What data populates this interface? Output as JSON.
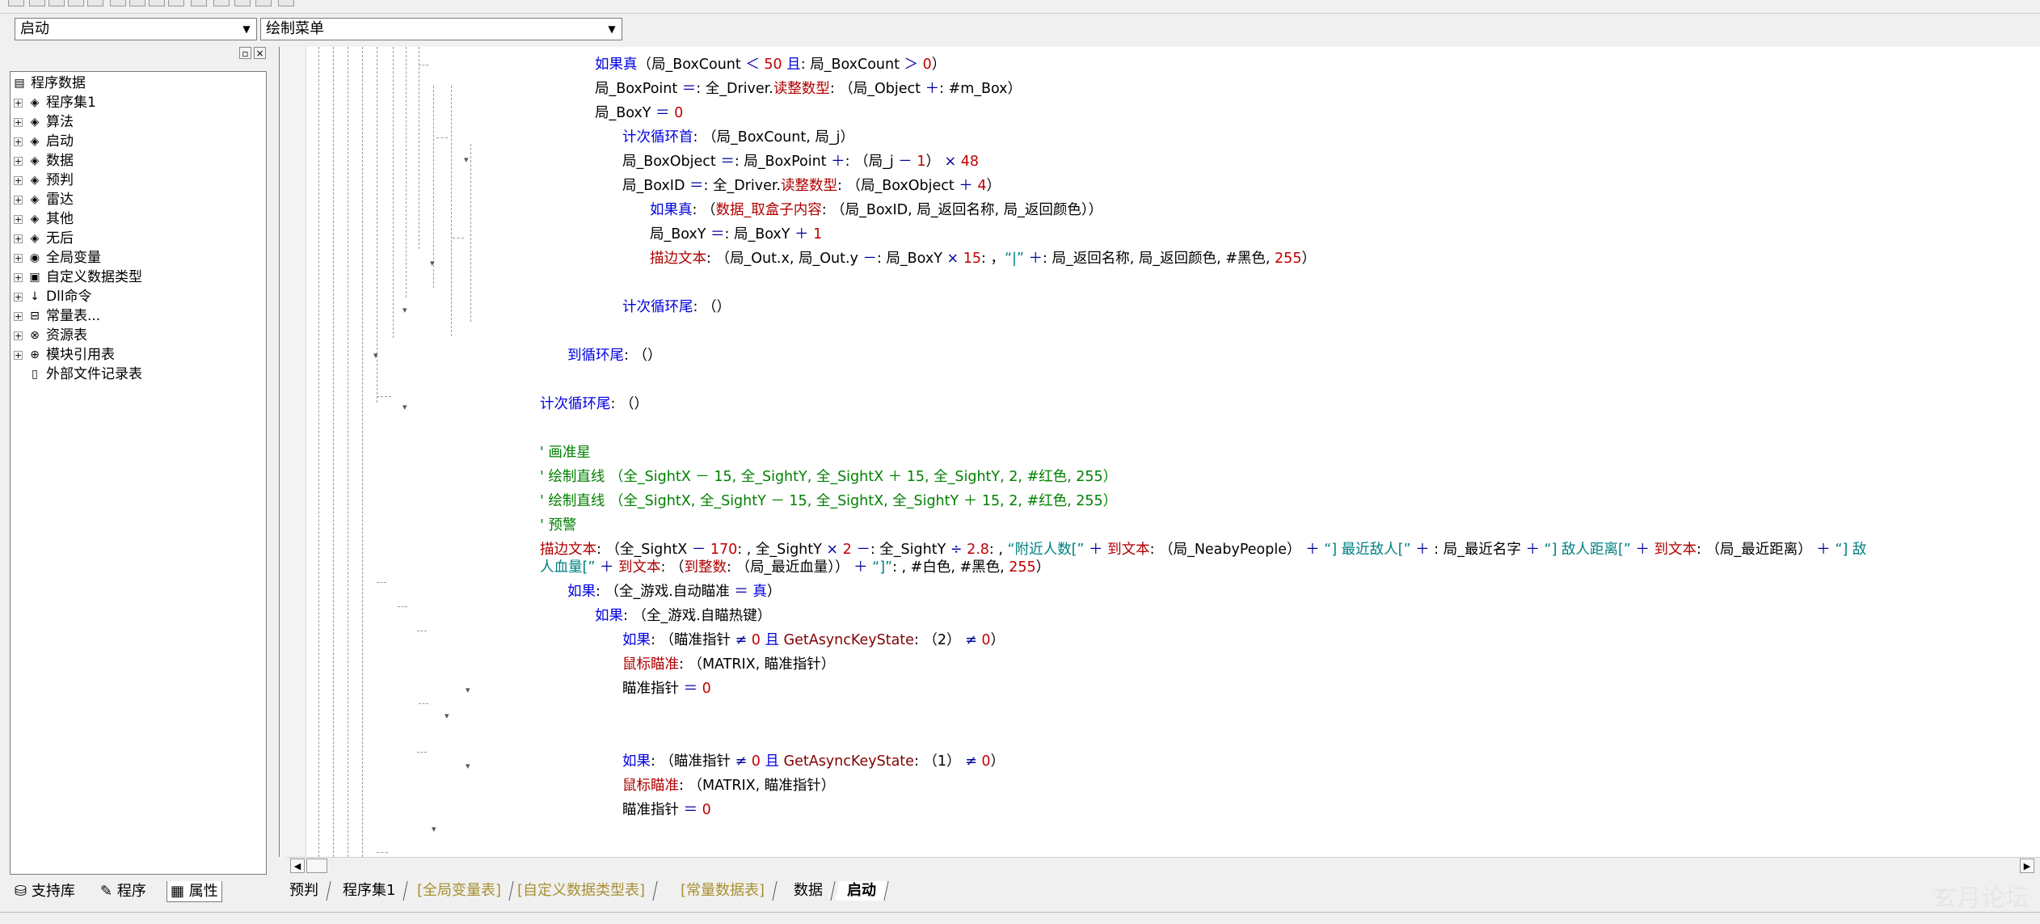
{
  "combos": {
    "left": "启动",
    "right": "绘制菜单"
  },
  "tree": {
    "root": "程序数据",
    "items": [
      {
        "label": "程序集1",
        "icon": "module-icon"
      },
      {
        "label": "算法",
        "icon": "module-icon"
      },
      {
        "label": "启动",
        "icon": "module-icon"
      },
      {
        "label": "数据",
        "icon": "module-icon"
      },
      {
        "label": "预判",
        "icon": "module-icon"
      },
      {
        "label": "雷达",
        "icon": "module-icon"
      },
      {
        "label": "其他",
        "icon": "module-icon"
      },
      {
        "label": "无后",
        "icon": "module-icon"
      },
      {
        "label": "全局变量",
        "icon": "global-var-icon"
      },
      {
        "label": "自定义数据类型",
        "icon": "custom-type-icon"
      },
      {
        "label": "Dll命令",
        "icon": "dll-icon"
      },
      {
        "label": "常量表...",
        "icon": "const-icon"
      },
      {
        "label": "资源表",
        "icon": "resource-icon"
      },
      {
        "label": "模块引用表",
        "icon": "module-ref-icon"
      },
      {
        "label": "外部文件记录表",
        "icon": "file-icon"
      }
    ]
  },
  "left_tabs": [
    "支持库",
    "程序",
    "属性"
  ],
  "code": [
    [
      [
        "kw",
        "如果真"
      ],
      [
        "",
        "（局_BoxCount "
      ],
      [
        "op",
        "＜"
      ],
      [
        "num",
        " 50 "
      ],
      [
        "kw",
        "且"
      ],
      [
        "",
        ": 局_BoxCount "
      ],
      [
        "op",
        "＞"
      ],
      [
        "num",
        " 0"
      ],
      [
        "",
        "）"
      ]
    ],
    [
      [
        "",
        "局_BoxPoint "
      ],
      [
        "op",
        "＝"
      ],
      [
        "",
        ": 全_Driver."
      ],
      [
        "cmd",
        "读整数型"
      ],
      [
        "",
        ": （局_Object "
      ],
      [
        "op",
        "＋"
      ],
      [
        "",
        ": #m_Box）"
      ]
    ],
    [
      [
        "",
        "局_BoxY "
      ],
      [
        "op",
        "＝"
      ],
      [
        "num",
        " 0"
      ]
    ],
    [
      [
        "kw",
        "计次循环首"
      ],
      [
        "",
        ": （局_BoxCount, 局_j）"
      ]
    ],
    [
      [
        "",
        "局_BoxObject "
      ],
      [
        "op",
        "＝"
      ],
      [
        "",
        ": 局_BoxPoint "
      ],
      [
        "op",
        "＋"
      ],
      [
        "",
        ": （局_j "
      ],
      [
        "op",
        "－"
      ],
      [
        "num",
        " 1"
      ],
      [
        "",
        "）"
      ],
      [
        "op",
        " ×"
      ],
      [
        "num",
        " 48"
      ]
    ],
    [
      [
        "",
        "局_BoxID "
      ],
      [
        "op",
        "＝"
      ],
      [
        "",
        ": 全_Driver."
      ],
      [
        "cmd",
        "读整数型"
      ],
      [
        "",
        ": （局_BoxObject "
      ],
      [
        "op",
        "＋"
      ],
      [
        "num",
        " 4"
      ],
      [
        "",
        "）"
      ]
    ],
    [
      [
        "kw",
        "如果真"
      ],
      [
        "",
        ": （"
      ],
      [
        "cmd",
        "数据_取盒子内容"
      ],
      [
        "",
        ": （局_BoxID, 局_返回名称, 局_返回颜色））"
      ]
    ],
    [
      [
        "",
        "局_BoxY "
      ],
      [
        "op",
        "＝"
      ],
      [
        "",
        ": 局_BoxY "
      ],
      [
        "op",
        "＋"
      ],
      [
        "num",
        " 1"
      ]
    ],
    [
      [
        "cmd",
        "描边文本"
      ],
      [
        "",
        ": （局_Out.x, 局_Out.y "
      ],
      [
        "op",
        "－"
      ],
      [
        "",
        ": 局_BoxY "
      ],
      [
        "op",
        "×"
      ],
      [
        "num",
        " 15"
      ],
      [
        "",
        ": ，"
      ],
      [
        "str",
        "“|”"
      ],
      [
        "op",
        " ＋"
      ],
      [
        "",
        ": 局_返回名称, 局_返回颜色, #黑色, "
      ],
      [
        "num",
        "255"
      ],
      [
        "",
        "）"
      ]
    ],
    [
      [
        "kw",
        "计次循环尾"
      ],
      [
        "",
        ": （）"
      ]
    ],
    [
      [
        "kw",
        "到循环尾"
      ],
      [
        "",
        ": （）"
      ]
    ],
    [
      [
        "kw",
        "计次循环尾"
      ],
      [
        "",
        ": （）"
      ]
    ],
    [
      [
        "cmt",
        "' 画准星"
      ]
    ],
    [
      [
        "cmt",
        "' 绘制直线 （全_SightX － 15, 全_SightY, 全_SightX ＋ 15, 全_SightY, 2, #红色, 255）"
      ]
    ],
    [
      [
        "cmt",
        "' 绘制直线 （全_SightX, 全_SightY － 15, 全_SightX, 全_SightY ＋ 15, 2, #红色, 255）"
      ]
    ],
    [
      [
        "cmt",
        "' 预警"
      ]
    ],
    [
      [
        "cmd",
        "描边文本"
      ],
      [
        "",
        ": （全_SightX "
      ],
      [
        "op",
        "－"
      ],
      [
        "num",
        " 170"
      ],
      [
        "",
        ": , 全_SightY "
      ],
      [
        "op",
        "×"
      ],
      [
        "num",
        " 2 "
      ],
      [
        "op",
        "－"
      ],
      [
        "",
        ": 全_SightY "
      ],
      [
        "op",
        "÷"
      ],
      [
        "num",
        " 2.8"
      ],
      [
        "",
        ": , "
      ],
      [
        "str",
        "“附近人数[”"
      ],
      [
        "op",
        " ＋ "
      ],
      [
        "cmd",
        "到文本"
      ],
      [
        "",
        ": （局_NeabyPeople）"
      ],
      [
        "op",
        " ＋ "
      ],
      [
        "str",
        "“] 最近敌人[”"
      ],
      [
        "op",
        " ＋ "
      ],
      [
        "",
        ": 局_最近名字 "
      ],
      [
        "op",
        "＋ "
      ],
      [
        "str",
        "“] 敌人距离[”"
      ],
      [
        "op",
        " ＋ "
      ],
      [
        "cmd",
        "到文本"
      ],
      [
        "",
        ": （局_最近距离）"
      ],
      [
        "op",
        " ＋ "
      ],
      [
        "str",
        "“] 敌"
      ]
    ],
    [
      [
        "str",
        "人血量[”"
      ],
      [
        "op",
        " ＋ "
      ],
      [
        "cmd",
        "到文本"
      ],
      [
        "",
        ": （"
      ],
      [
        "cmd",
        "到整数"
      ],
      [
        "",
        ": （局_最近血量））"
      ],
      [
        "op",
        " ＋ "
      ],
      [
        "str",
        "“]”"
      ],
      [
        "",
        ": , #白色, #黑色, "
      ],
      [
        "num",
        "255"
      ],
      [
        "",
        "）"
      ]
    ],
    [
      [
        "kw",
        "如果"
      ],
      [
        "",
        ": （全_游戏.自动瞄准 "
      ],
      [
        "op",
        "＝"
      ],
      [
        "kw",
        " 真"
      ],
      [
        "",
        "）"
      ]
    ],
    [
      [
        "kw",
        "如果"
      ],
      [
        "",
        ": （全_游戏.自瞄热键）"
      ]
    ],
    [
      [
        "kw",
        "如果"
      ],
      [
        "",
        ": （瞄准指针 "
      ],
      [
        "op",
        "≠"
      ],
      [
        "num",
        " 0 "
      ],
      [
        "kw",
        "且"
      ],
      [
        "api",
        " GetAsyncKeyState"
      ],
      [
        "",
        ": （2）"
      ],
      [
        "op",
        " ≠"
      ],
      [
        "num",
        " 0"
      ],
      [
        "",
        "）"
      ]
    ],
    [
      [
        "cmd",
        "鼠标瞄准"
      ],
      [
        "",
        ": （MATRIX, 瞄准指针）"
      ]
    ],
    [
      [
        "",
        "瞄准指针 "
      ],
      [
        "op",
        "＝"
      ],
      [
        "num",
        " 0"
      ]
    ],
    [
      [
        "kw",
        "如果"
      ],
      [
        "",
        ": （瞄准指针 "
      ],
      [
        "op",
        "≠"
      ],
      [
        "num",
        " 0 "
      ],
      [
        "kw",
        "且"
      ],
      [
        "api",
        " GetAsyncKeyState"
      ],
      [
        "",
        ": （1）"
      ],
      [
        "op",
        " ≠"
      ],
      [
        "num",
        " 0"
      ],
      [
        "",
        "）"
      ]
    ],
    [
      [
        "cmd",
        "鼠标瞄准"
      ],
      [
        "",
        ": （MATRIX, 瞄准指针）"
      ]
    ],
    [
      [
        "",
        "瞄准指针 "
      ],
      [
        "op",
        "＝"
      ],
      [
        "num",
        " 0"
      ]
    ]
  ],
  "doc_tabs": [
    {
      "label": "预判",
      "kind": "normal"
    },
    {
      "label": "程序集1",
      "kind": "normal"
    },
    {
      "label": "[全局变量表]",
      "kind": "lib"
    },
    {
      "label": "[自定义数据类型表]",
      "kind": "lib"
    },
    {
      "label": "[常量数据表]",
      "kind": "lib"
    },
    {
      "label": "数据",
      "kind": "normal"
    },
    {
      "label": "启动",
      "kind": "active"
    }
  ],
  "watermark": "玄月论坛"
}
